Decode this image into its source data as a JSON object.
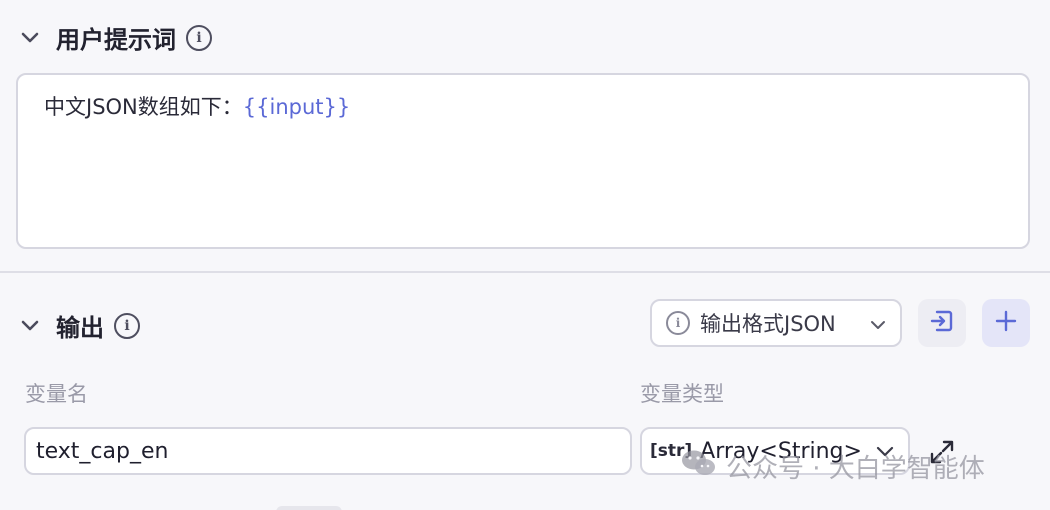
{
  "prompt_section": {
    "title": "用户提示词",
    "prompt_text": "中文JSON数组如下：",
    "prompt_variable": "{{input}}"
  },
  "output_section": {
    "title": "输出",
    "format_select": "输出格式JSON",
    "columns": {
      "var_name": "变量名",
      "var_type": "变量类型"
    },
    "variable": {
      "name": "text_cap_en",
      "type_badge": "[str]",
      "type": "Array<String>"
    }
  },
  "watermark": "公众号 · 大白学智能体",
  "colors": {
    "accent": "#5b69d6",
    "button_bg": "#e9eaf8"
  }
}
